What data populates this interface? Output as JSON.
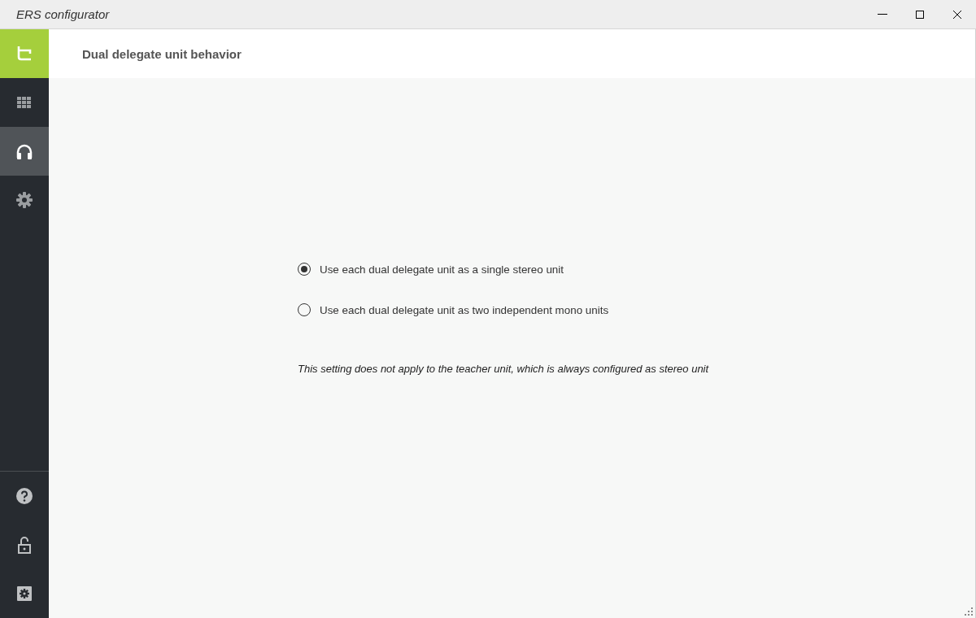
{
  "window": {
    "title": "ERS configurator"
  },
  "sidebar": {
    "nav_items": [
      {
        "kind": "grid",
        "selected": false
      },
      {
        "kind": "headphones",
        "selected": true
      },
      {
        "kind": "gear",
        "selected": false
      }
    ],
    "bottom_items": [
      {
        "kind": "help"
      },
      {
        "kind": "lock"
      },
      {
        "kind": "settings"
      }
    ]
  },
  "header": {
    "title": "Dual delegate unit behavior"
  },
  "options": [
    {
      "label": "Use each dual delegate unit as a single stereo unit",
      "selected": true
    },
    {
      "label": "Use each dual delegate unit as two independent mono units",
      "selected": false
    }
  ],
  "note": "This setting does not apply to the teacher unit, which is always configured as stereo unit"
}
